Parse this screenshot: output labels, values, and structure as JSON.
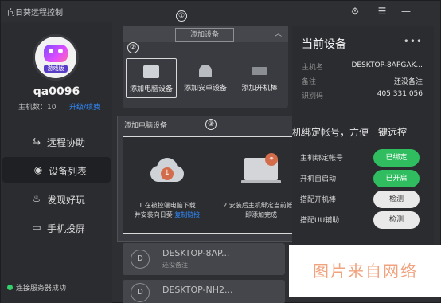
{
  "app": {
    "title": "向日葵远程控制"
  },
  "window_controls": {
    "settings_icon": "gear-icon",
    "menu_icon": "menu-icon",
    "minimize_icon": "minimize-icon"
  },
  "profile": {
    "avatar_badge": "游戏版",
    "username": "qa0096",
    "host_count": "主机数：10",
    "upgrade": "升级/续费"
  },
  "nav": {
    "items": [
      {
        "label": "远程协助",
        "icon": "remote-assist-icon"
      },
      {
        "label": "设备列表",
        "icon": "device-list-icon"
      },
      {
        "label": "发现好玩",
        "icon": "discover-icon"
      },
      {
        "label": "手机投屏",
        "icon": "screen-cast-icon"
      }
    ],
    "active": "设备列表"
  },
  "status": {
    "text": "连接服务器成功",
    "color": "#33d26b"
  },
  "markers": [
    "①",
    "②",
    "③"
  ],
  "add_panel": {
    "header_button": "添加设备",
    "options": [
      {
        "label": "添加电脑设备",
        "icon": "monitor-icon"
      },
      {
        "label": "添加安卓设备",
        "icon": "android-icon"
      },
      {
        "label": "添加开机棒",
        "icon": "boot-stick-icon"
      }
    ]
  },
  "dialog": {
    "title": "添加电脑设备",
    "step1_line1": "1 在被控端电脑下载",
    "step1_line2_prefix": "并安装向日葵 ",
    "step1_link": "复制链接",
    "step2_line1": "2 安装后主机绑定当前帐号",
    "step2_line2": "即添加完成"
  },
  "devices": [
    {
      "avatar": "D",
      "name": "DESKTOP-8AP...",
      "sub": "还没备注"
    },
    {
      "avatar": "D",
      "name": "DESKTOP-NH2...",
      "sub": ""
    }
  ],
  "current_device": {
    "title": "当前设备",
    "more": "•••",
    "fields": [
      {
        "key": "主机名",
        "value": "DESKTOP-8APGAK..."
      },
      {
        "key": "备注",
        "value": "还没备注"
      },
      {
        "key": "识别码",
        "value": "405 331 056"
      }
    ],
    "heading": "机绑定帐号，方便一键远控",
    "settings": [
      {
        "label": "主机绑定帐号",
        "button": "已绑定",
        "state": "on"
      },
      {
        "label": "开机自启动",
        "button": "已开启",
        "state": "on"
      },
      {
        "label": "搭配开机棒",
        "button": "检测",
        "state": "off"
      },
      {
        "label": "搭配UU辅助",
        "button": "检测",
        "state": "off"
      }
    ]
  },
  "watermark": "图片来自网络",
  "colors": {
    "accent_green": "#2fbd60",
    "link_blue": "#2f8cff",
    "cloud_orange": "#d36c4b"
  }
}
